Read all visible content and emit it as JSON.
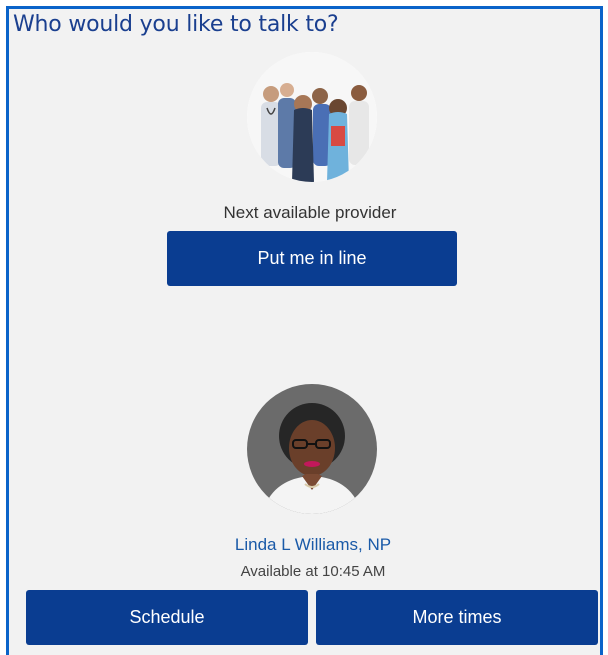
{
  "header": {
    "title": "Who would you like to talk to?"
  },
  "next_available": {
    "label": "Next available provider",
    "button_label": "Put me in line"
  },
  "provider": {
    "name": "Linda L Williams, NP",
    "availability": "Available at 10:45 AM",
    "schedule_label": "Schedule",
    "more_times_label": "More times"
  },
  "colors": {
    "accent_border": "#0a63c9",
    "button_bg": "#0a3d91",
    "title_text": "#1a3f8f",
    "link_text": "#1a5aa8",
    "panel_bg": "#f2f2f2"
  }
}
